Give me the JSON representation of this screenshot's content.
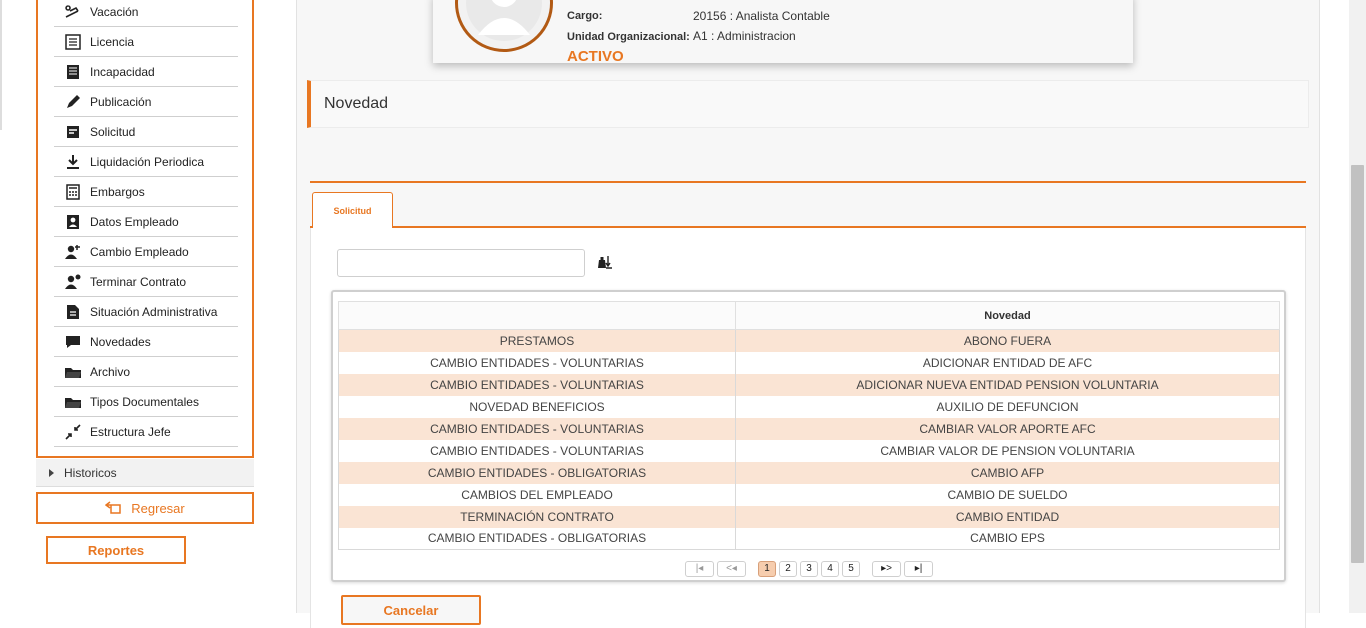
{
  "sidebar": {
    "menu": [
      {
        "label": "Vacación",
        "icon": "vacation-icon"
      },
      {
        "label": "Licencia",
        "icon": "license-icon"
      },
      {
        "label": "Incapacidad",
        "icon": "disability-icon"
      },
      {
        "label": "Publicación",
        "icon": "pen-icon"
      },
      {
        "label": "Solicitud",
        "icon": "request-icon"
      },
      {
        "label": "Liquidación Periodica",
        "icon": "download-icon"
      },
      {
        "label": "Embargos",
        "icon": "calculator-icon"
      },
      {
        "label": "Datos Empleado",
        "icon": "employee-card-icon"
      },
      {
        "label": "Cambio Empleado",
        "icon": "user-change-icon"
      },
      {
        "label": "Terminar Contrato",
        "icon": "user-remove-icon"
      },
      {
        "label": "Situación Administrativa",
        "icon": "document-icon"
      },
      {
        "label": "Novedades",
        "icon": "chat-icon"
      },
      {
        "label": "Archivo",
        "icon": "folder-icon"
      },
      {
        "label": "Tipos Documentales",
        "icon": "folder-open-icon"
      },
      {
        "label": "Estructura Jefe",
        "icon": "compress-icon"
      }
    ],
    "historicos": "Historicos",
    "regresar": "Regresar",
    "reportes": "Reportes"
  },
  "profile": {
    "cargo_label": "Cargo:",
    "cargo_value": "20156 : Analista Contable",
    "unidad_label": "Unidad Organizacional:",
    "unidad_value": "A1 : Administracion",
    "status": "ACTIVO"
  },
  "panel": {
    "title": "Novedad"
  },
  "tabs": [
    {
      "label": "Solicitud"
    }
  ],
  "search": {
    "value": "",
    "placeholder": ""
  },
  "grid": {
    "columns": [
      "",
      "Novedad"
    ],
    "rows": [
      [
        "PRESTAMOS",
        "ABONO FUERA"
      ],
      [
        "CAMBIO ENTIDADES - VOLUNTARIAS",
        "ADICIONAR ENTIDAD DE AFC"
      ],
      [
        "CAMBIO ENTIDADES - VOLUNTARIAS",
        "ADICIONAR NUEVA ENTIDAD PENSION VOLUNTARIA"
      ],
      [
        "NOVEDAD BENEFICIOS",
        "AUXILIO DE DEFUNCION"
      ],
      [
        "CAMBIO ENTIDADES - VOLUNTARIAS",
        "CAMBIAR VALOR APORTE AFC"
      ],
      [
        "CAMBIO ENTIDADES - VOLUNTARIAS",
        "CAMBIAR VALOR DE PENSION VOLUNTARIA"
      ],
      [
        "CAMBIO ENTIDADES - OBLIGATORIAS",
        "CAMBIO AFP"
      ],
      [
        "CAMBIOS DEL EMPLEADO",
        "CAMBIO DE SUELDO"
      ],
      [
        "TERMINACIÓN CONTRATO",
        "CAMBIO ENTIDAD"
      ],
      [
        "CAMBIO ENTIDADES - OBLIGATORIAS",
        "CAMBIO EPS"
      ]
    ]
  },
  "pager": {
    "first": "|◂",
    "prev": "<◂",
    "pages": [
      "1",
      "2",
      "3",
      "4",
      "5"
    ],
    "active_page": "1",
    "next": "▸>",
    "last": "▸|"
  },
  "actions": {
    "cancelar": "Cancelar"
  },
  "colors": {
    "accent": "#e87722",
    "row_alt": "#fae4d4"
  }
}
